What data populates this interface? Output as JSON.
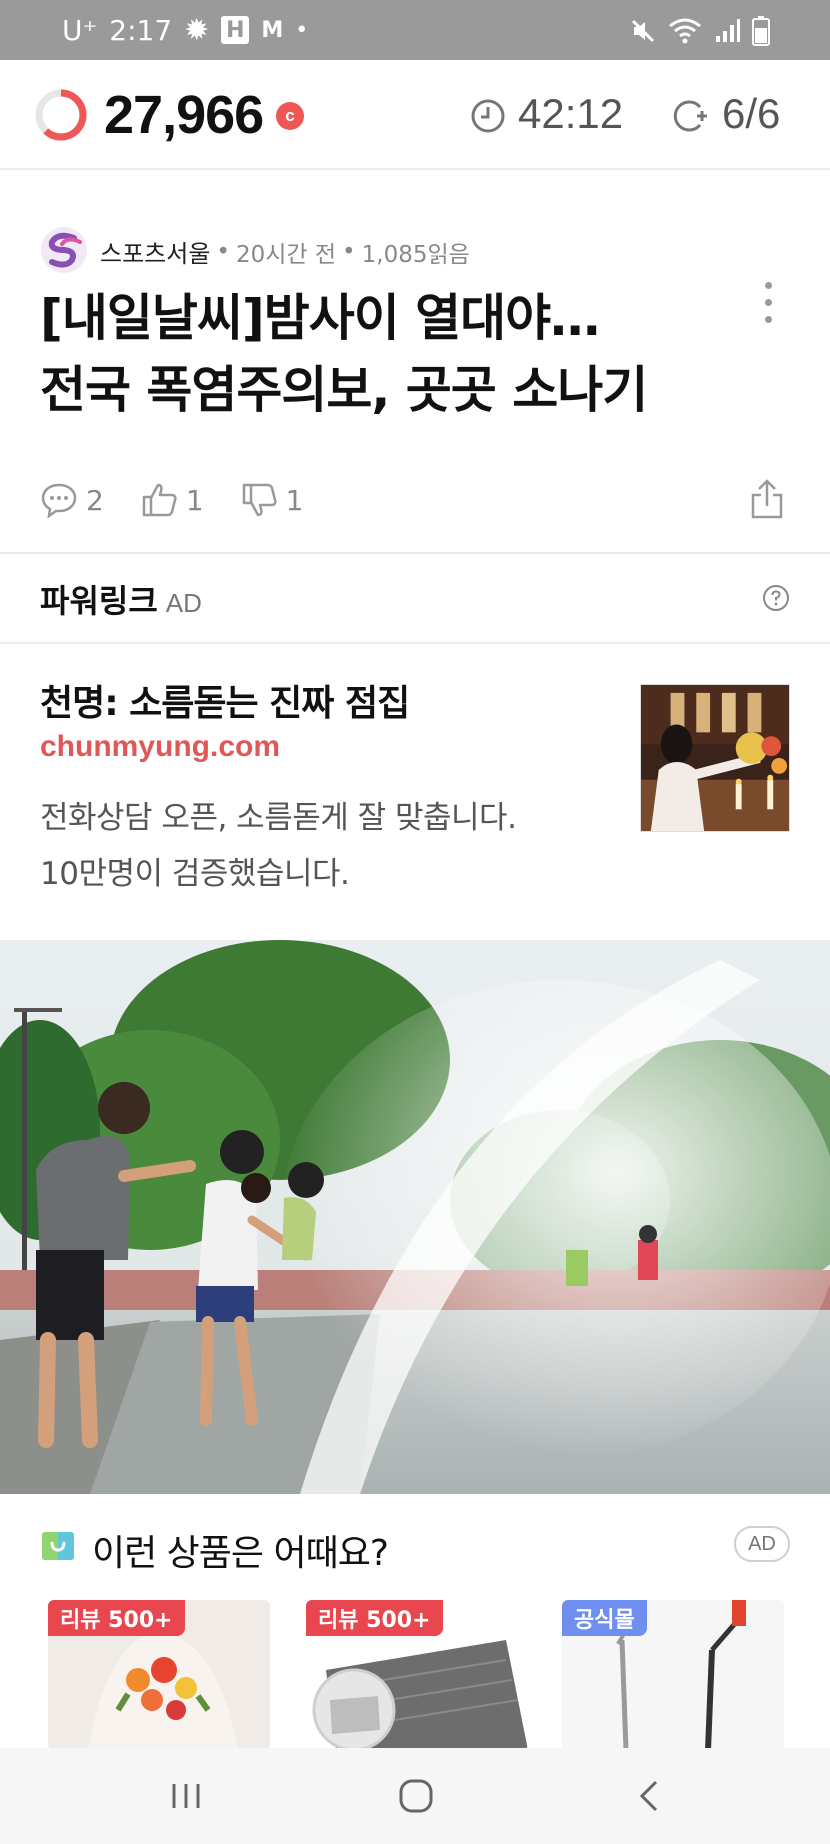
{
  "status_bar": {
    "carrier": "U⁺",
    "time": "2:17",
    "h_badge": "H",
    "m_glyph": "M",
    "dot": "•",
    "icons": [
      "gear-icon",
      "mute-icon",
      "wifi-icon",
      "signal-icon",
      "battery-icon"
    ]
  },
  "reward_bar": {
    "points": "27,966",
    "coin_badge": "c",
    "timer": "42:12",
    "progress": "6/6",
    "ring_fraction": 0.62,
    "accent_color": "#ef5656"
  },
  "article": {
    "source": "스포츠서울",
    "time_ago": "20시간 전",
    "reads": "1,085읽음",
    "separator": "•",
    "headline_line1": "[내일날씨]밤사이 열대야…",
    "headline_line2": "전국 폭염주의보, 곳곳 소나기",
    "reactions": {
      "comments": "2",
      "likes": "1",
      "dislikes": "1"
    }
  },
  "powerlink": {
    "title": "파워링크",
    "ad_label": "AD",
    "ad": {
      "title": "천명: 소름돋는 진짜 점집",
      "url": "chunmyung.com",
      "desc_line1": "전화상담 오픈, 소름돋게 잘 맞춥니다.",
      "desc_line2": "10만명이 검증했습니다."
    }
  },
  "recommend": {
    "title": "이런 상품은 어때요?",
    "ad_pill": "AD",
    "products": [
      {
        "tag": "리뷰 500+",
        "tag_color": "#e9474f"
      },
      {
        "tag": "리뷰 500+",
        "tag_color": "#e9474f"
      },
      {
        "tag": "공식몰",
        "tag_color": "#6f8ff0"
      }
    ]
  },
  "nav_bar": {
    "buttons": [
      "recents-icon",
      "home-icon",
      "back-icon"
    ]
  }
}
